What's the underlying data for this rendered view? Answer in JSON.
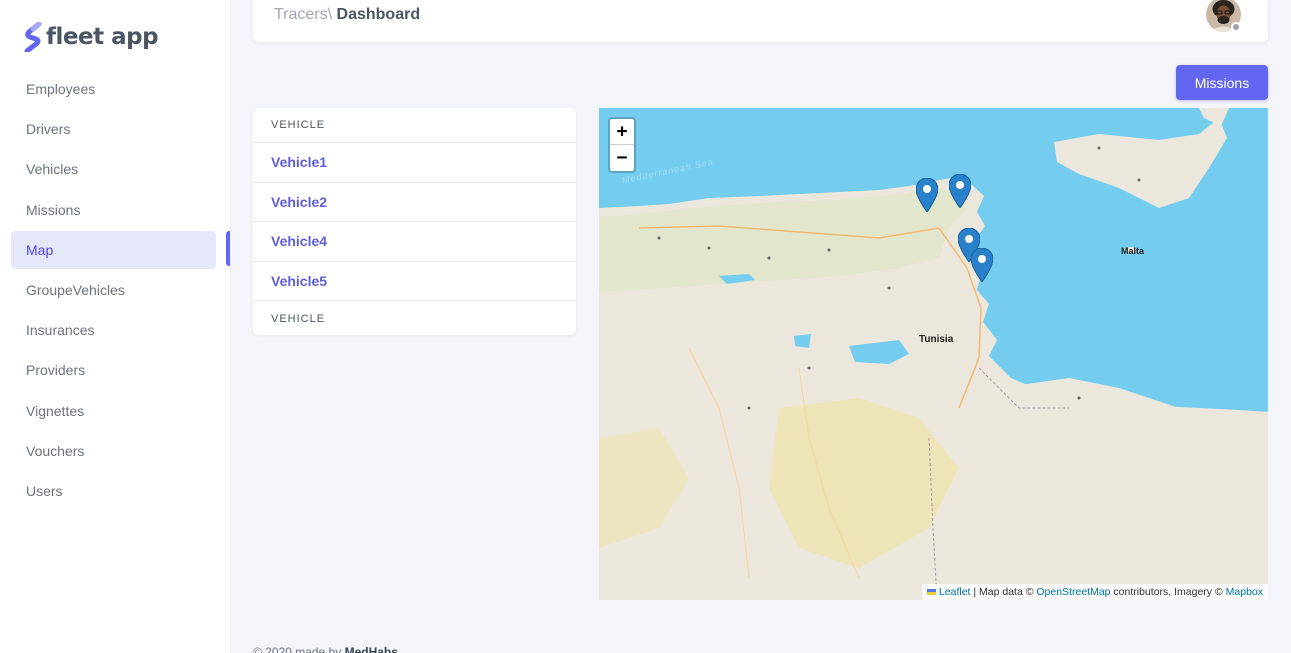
{
  "brand": {
    "name": "fleet app",
    "logo_icon": "brand-s-logo-icon",
    "logo_color": "#6366f1"
  },
  "sidebar": {
    "items": [
      {
        "label": "Employees",
        "active": false
      },
      {
        "label": "Drivers",
        "active": false
      },
      {
        "label": "Vehicles",
        "active": false
      },
      {
        "label": "Missions",
        "active": false
      },
      {
        "label": "Map",
        "active": true
      },
      {
        "label": "GroupeVehicles",
        "active": false
      },
      {
        "label": "Insurances",
        "active": false
      },
      {
        "label": "Providers",
        "active": false
      },
      {
        "label": "Vignettes",
        "active": false
      },
      {
        "label": "Vouchers",
        "active": false
      },
      {
        "label": "Users",
        "active": false
      }
    ]
  },
  "header": {
    "breadcrumb_root": "Tracers\\",
    "breadcrumb_current": "Dashboard"
  },
  "actions": {
    "missions_label": "Missions"
  },
  "vehicle_table": {
    "header": "VEHICLE",
    "footer": "VEHICLE",
    "rows": [
      "Vehicle1",
      "Vehicle2",
      "Vehicle4",
      "Vehicle5"
    ]
  },
  "map": {
    "zoom_in": "+",
    "zoom_out": "−",
    "country_label": "Tunisia",
    "sea_label": "Mediterranean Sea",
    "malta_label": "Malta",
    "attribution": {
      "leaflet": "Leaflet",
      "sep1": " | Map data © ",
      "osm": "OpenStreetMap",
      "sep2": " contributors, Imagery © ",
      "mapbox": "Mapbox"
    },
    "marker_icon": "map-marker-icon",
    "marker_color": "#2a81cb",
    "water_color": "#74cdee",
    "land_color": "#ece7dc"
  },
  "footer": {
    "prefix": "© 2020 made by ",
    "author": "MedHabs"
  },
  "colors": {
    "accent": "#6366f1",
    "active_bg": "#e5e7fb",
    "link": "#5b5fd8"
  }
}
